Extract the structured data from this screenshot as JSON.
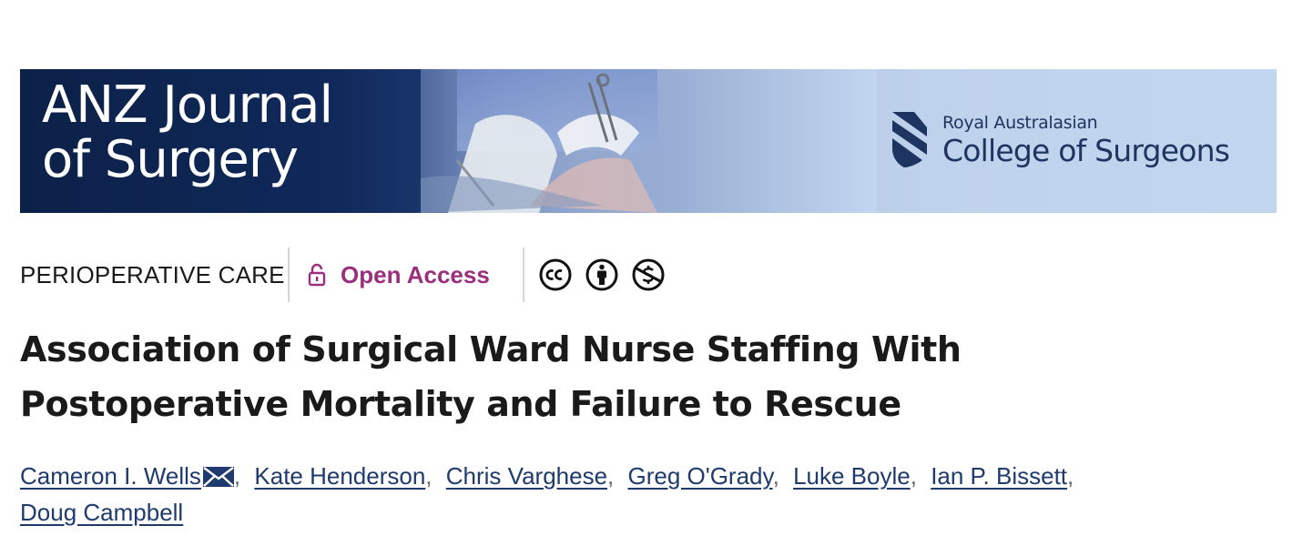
{
  "banner": {
    "journal_title_line1": "ANZ Journal",
    "journal_title_line2": "of Surgery",
    "society_small": "Royal Australasian",
    "society_big": "College of Surgeons"
  },
  "meta": {
    "category": "PERIOPERATIVE CARE",
    "access_label": "Open Access",
    "license_icons": [
      "cc-icon",
      "by-icon",
      "nc-icon"
    ]
  },
  "article": {
    "title_line1": "Association of Surgical Ward Nurse Staffing With",
    "title_line2": "Postoperative Mortality and Failure to Rescue"
  },
  "authors": [
    "Cameron I. Wells",
    "Kate Henderson",
    "Chris Varghese",
    "Greg O'Grady",
    "Luke Boyle",
    "Ian P. Bissett",
    "Doug Campbell"
  ],
  "colors": {
    "banner_dark": "#0c2148",
    "banner_light": "#c2d6f0",
    "open_access": "#9b2f7e",
    "author_link": "#1e3a6e"
  }
}
